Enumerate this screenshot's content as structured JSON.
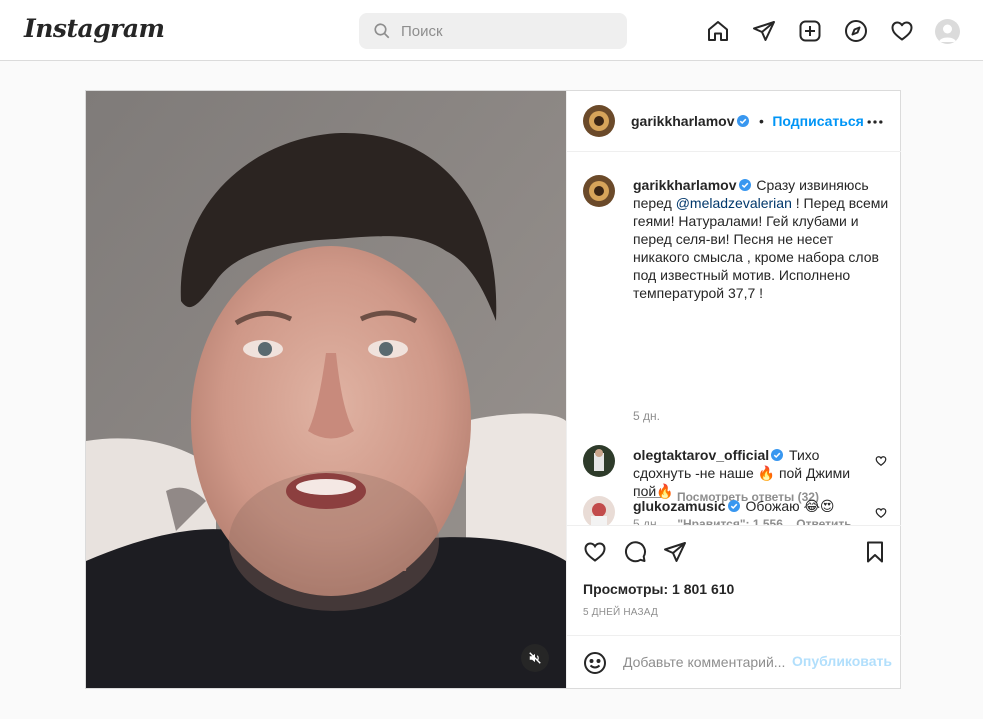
{
  "app": {
    "logo": "Instagram"
  },
  "search": {
    "placeholder": "Поиск"
  },
  "nav": {
    "icons": [
      "home-icon",
      "direct-icon",
      "new-post-icon",
      "explore-icon",
      "activity-heart-icon",
      "profile-avatar"
    ]
  },
  "post": {
    "author": "garikkharlamov",
    "follow_label": "Подписаться",
    "separator": "•",
    "caption": {
      "username": "garikkharlamov",
      "text_before": "Сразу извиняюсь перед ",
      "mention": "@meladzevalerian",
      "text_after": " ! Перед всеми геями! Натуралами! Гей клубами и перед селя-ви! Песня не несет никакого смысла , кроме набора слов под известный мотив. Исполнено температурой 37,7 !",
      "time": "5 дн."
    },
    "comments": [
      {
        "username": "olegtaktarov_official",
        "text": "Тихо сдохнуть -не наше 🔥 пой Джими пой🔥",
        "time": "5 дн.",
        "likes": "\"Нравится\": 1 556",
        "reply_label": "Ответить",
        "view_replies": "Посмотреть ответы (32)"
      },
      {
        "username": "glukozamusic",
        "text": "Обожаю 😂😍"
      }
    ],
    "views_label": "Просмотры: 1 801 610",
    "date_label": "5 ДНЕЙ НАЗАД",
    "add_comment_placeholder": "Добавьте комментарий...",
    "publish_label": "Опубликовать"
  },
  "colors": {
    "accent": "#0095f6",
    "mention": "#00376b",
    "publish_disabled": "#b2dffc",
    "border": "#dbdbdb"
  }
}
